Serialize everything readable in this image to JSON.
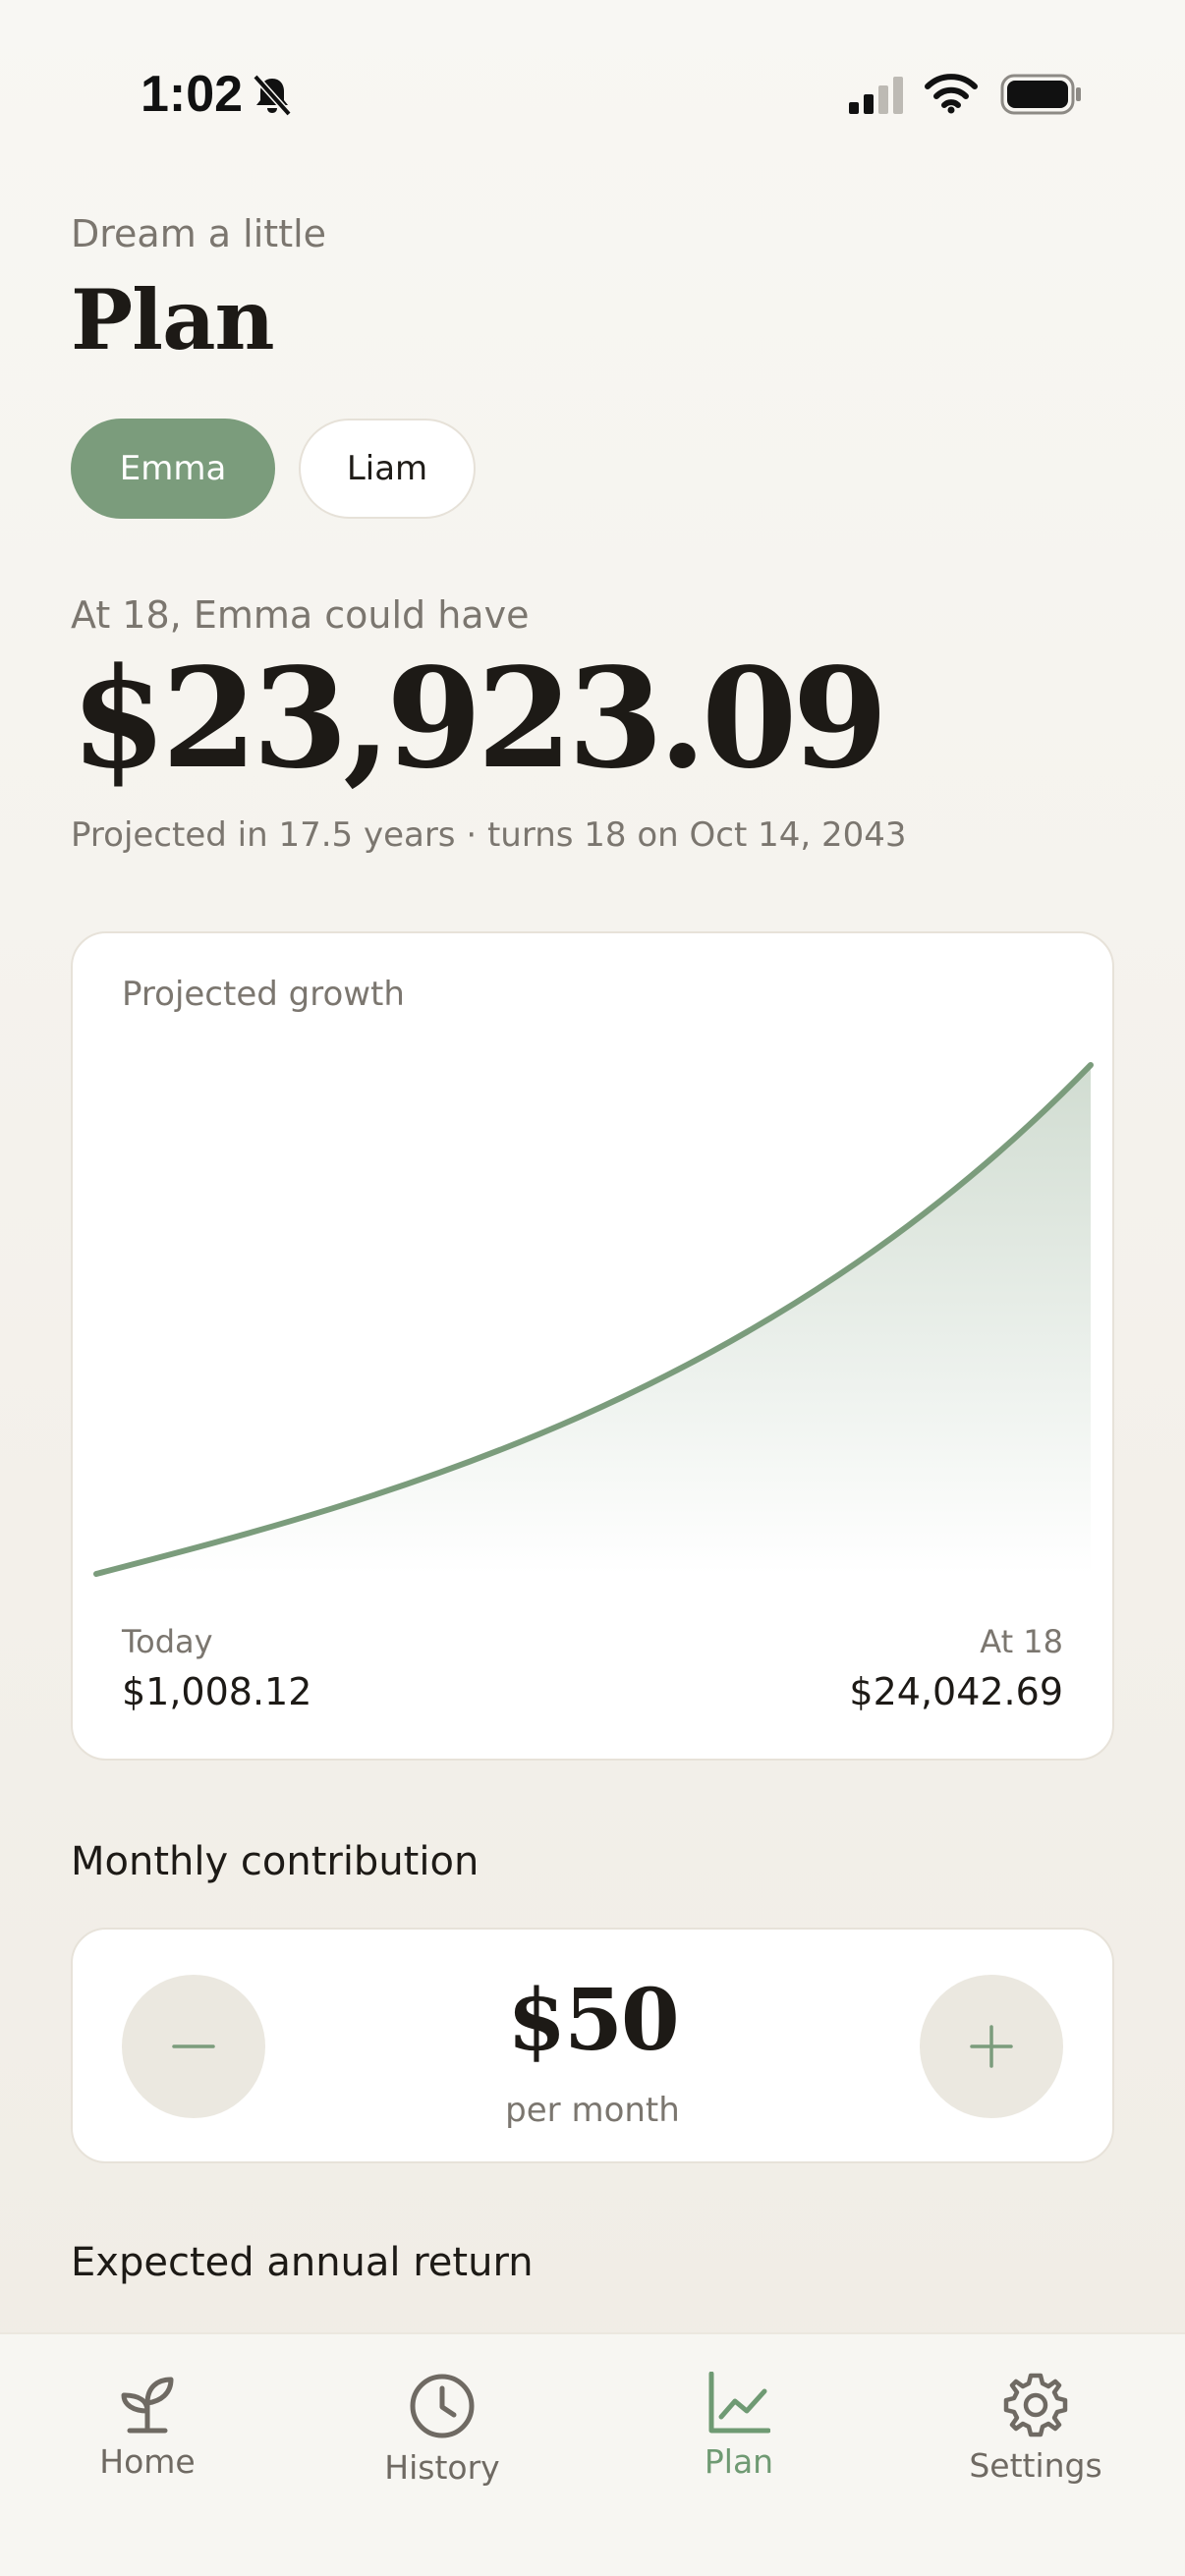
{
  "status_bar": {
    "time": "1:02",
    "icons": [
      "bell-slash-icon",
      "cellular-signal-icon",
      "wifi-icon",
      "battery-icon"
    ]
  },
  "header": {
    "eyebrow": "Dream a little",
    "title": "Plan"
  },
  "children": [
    {
      "label": "Emma",
      "selected": true
    },
    {
      "label": "Liam",
      "selected": false
    }
  ],
  "projection": {
    "subheading": "At 18, Emma could have",
    "amount": "$23,923.09",
    "note": "Projected in 17.5 years · turns 18 on Oct 14, 2043"
  },
  "growth_card": {
    "title": "Projected growth",
    "start_label": "Today",
    "start_value": "$1,008.12",
    "end_label": "At 18",
    "end_value": "$24,042.69"
  },
  "contribution": {
    "section_label": "Monthly contribution",
    "amount": "$50",
    "unit": "per month",
    "decrease_icon": "minus-icon",
    "increase_icon": "plus-icon"
  },
  "return_section": {
    "label": "Expected annual return"
  },
  "tab_bar": {
    "tabs": [
      {
        "label": "Home",
        "icon": "sprout-icon",
        "active": false
      },
      {
        "label": "History",
        "icon": "clock-icon",
        "active": false
      },
      {
        "label": "Plan",
        "icon": "chart-line-icon",
        "active": true
      },
      {
        "label": "Settings",
        "icon": "gear-icon",
        "active": false
      }
    ]
  },
  "colors": {
    "accent": "#7b9c7c",
    "background": "#f5f3ee",
    "card": "#ffffff",
    "text_primary": "#1d1a16",
    "text_secondary": "#7b766f"
  }
}
